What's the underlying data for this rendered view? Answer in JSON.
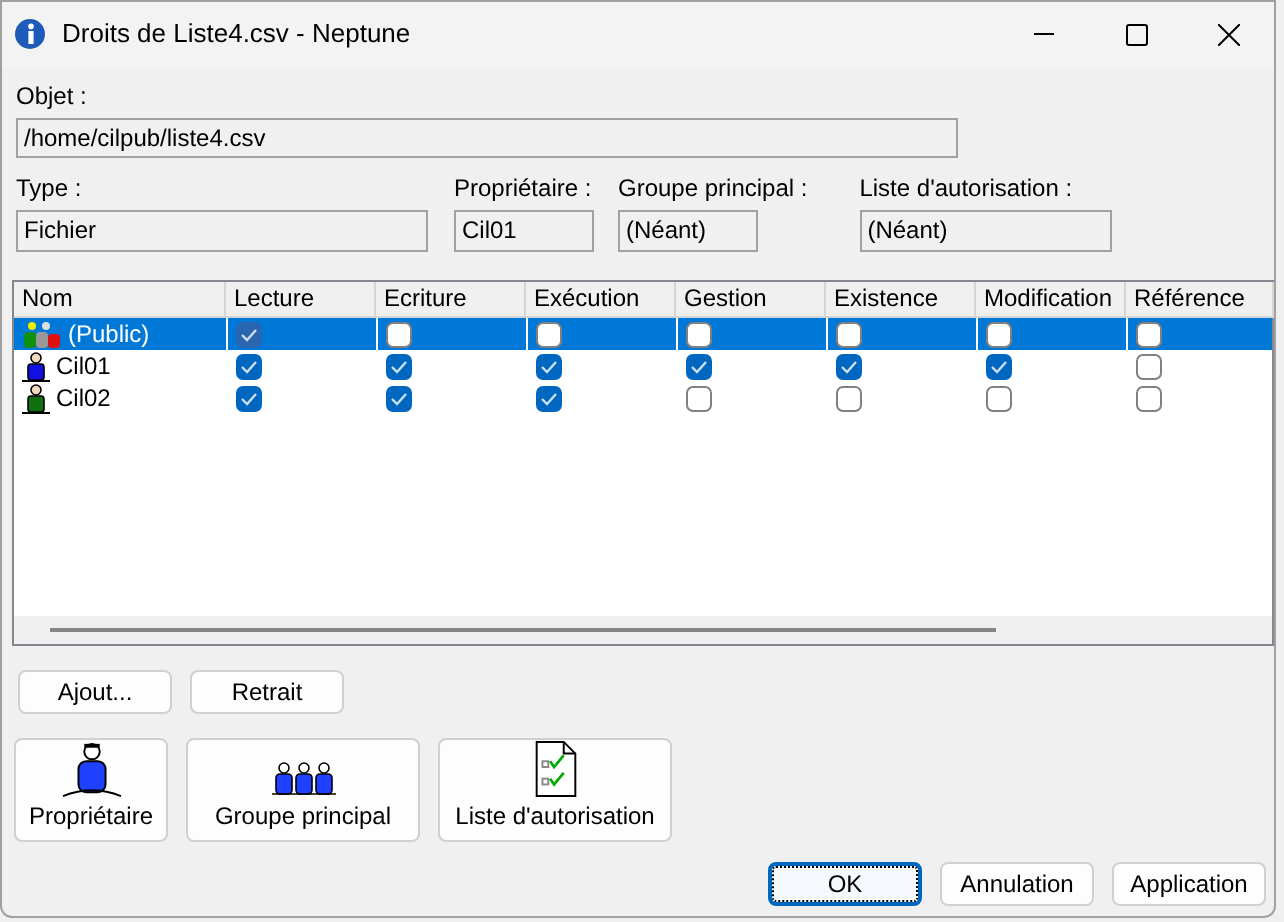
{
  "window": {
    "title": "Droits de Liste4.csv - Neptune"
  },
  "object": {
    "label": "Objet :",
    "value": "/home/cilpub/liste4.csv"
  },
  "info_fields": [
    {
      "label": "Type :",
      "value": "Fichier"
    },
    {
      "label": "Propriétaire :",
      "value": "Cil01"
    },
    {
      "label": "Groupe principal :",
      "value": "(Néant)"
    },
    {
      "label": "Liste d'autorisation :",
      "value": "(Néant)"
    }
  ],
  "table": {
    "columns": [
      "Nom",
      "Lecture",
      "Ecriture",
      "Exécution",
      "Gestion",
      "Existence",
      "Modification",
      "Référence"
    ],
    "rows": [
      {
        "name": "(Public)",
        "kind": "group",
        "selected": true,
        "permissions": [
          true,
          false,
          false,
          false,
          false,
          false,
          false
        ]
      },
      {
        "name": "Cil01",
        "kind": "user",
        "color": "#1010e0",
        "selected": false,
        "permissions": [
          true,
          true,
          true,
          true,
          true,
          true,
          false
        ]
      },
      {
        "name": "Cil02",
        "kind": "user",
        "color": "#107010",
        "selected": false,
        "permissions": [
          true,
          true,
          true,
          false,
          false,
          false,
          false
        ]
      }
    ]
  },
  "list_buttons": [
    "Ajout...",
    "Retrait"
  ],
  "large_buttons": [
    {
      "label": "Propriétaire",
      "kind": "owner"
    },
    {
      "label": "Groupe principal",
      "kind": "group"
    },
    {
      "label": "Liste d'autorisation",
      "kind": "list"
    }
  ],
  "dialog_buttons": [
    {
      "label": "OK",
      "default": true
    },
    {
      "label": "Annulation",
      "default": false
    },
    {
      "label": "Application",
      "default": false
    }
  ]
}
